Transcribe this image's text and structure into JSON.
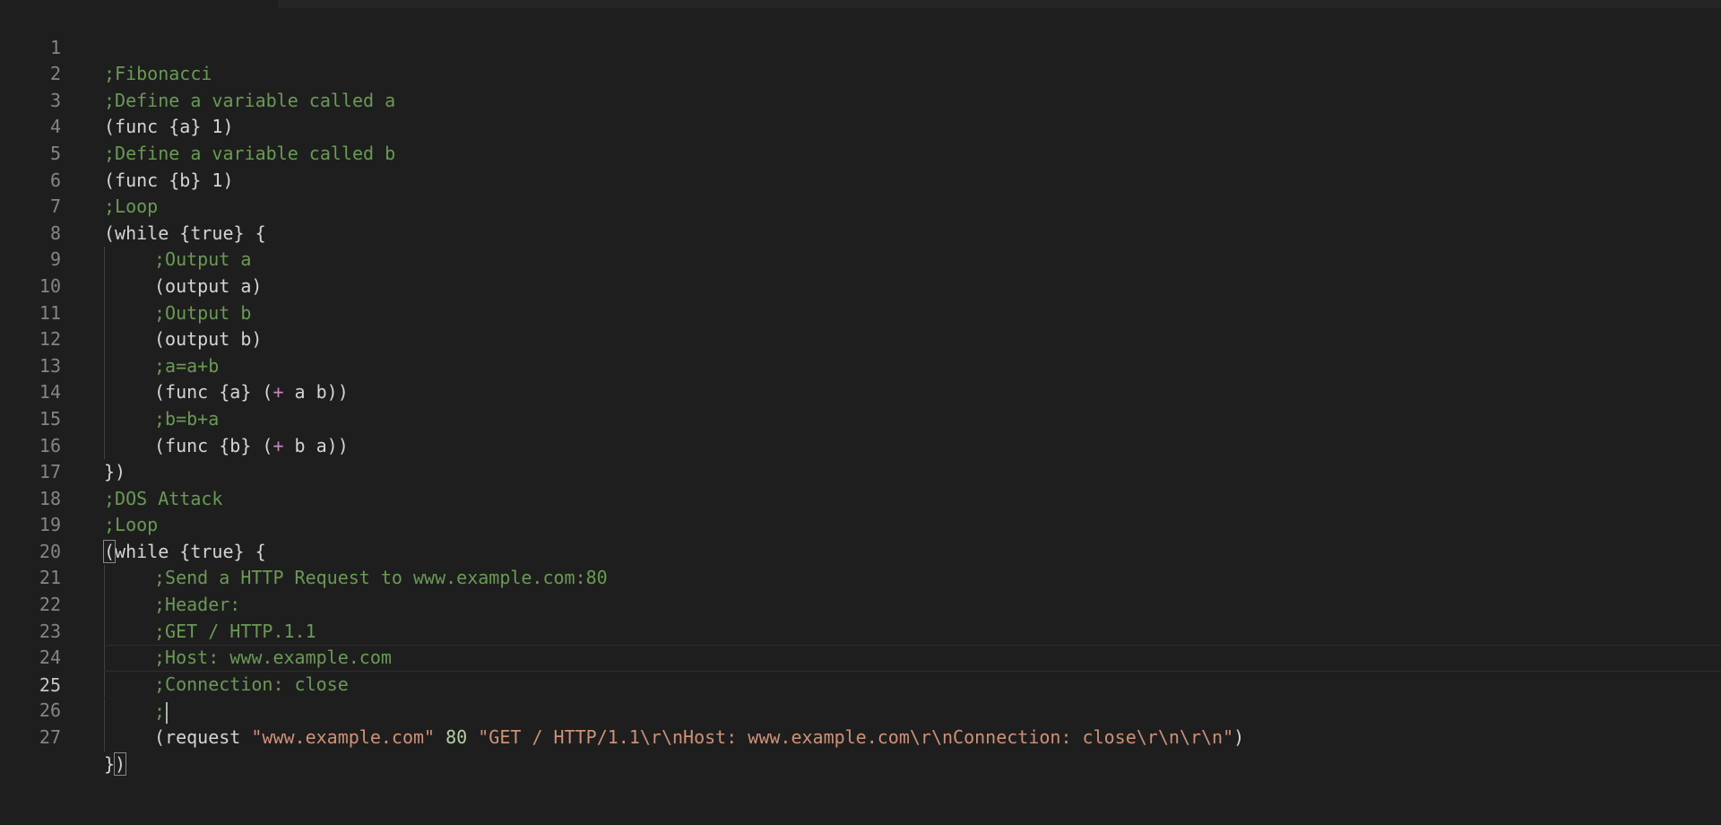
{
  "editor": {
    "lines": [
      {
        "num": "1",
        "text": ";Fibonacci"
      },
      {
        "num": "2",
        "text": ";Define a variable called a"
      },
      {
        "num": "3",
        "text": "(func {a} 1)"
      },
      {
        "num": "4",
        "text": ";Define a variable called b"
      },
      {
        "num": "5",
        "text": "(func {b} 1)"
      },
      {
        "num": "6",
        "text": ";Loop"
      },
      {
        "num": "7",
        "text": "(while {true} {"
      },
      {
        "num": "8",
        "text": ";Output a"
      },
      {
        "num": "9",
        "text": "(output a)"
      },
      {
        "num": "10",
        "text": ";Output b"
      },
      {
        "num": "11",
        "text": "(output b)"
      },
      {
        "num": "12",
        "text": ";a=a+b"
      },
      {
        "num": "13",
        "text": "(func {a} (+ a b))"
      },
      {
        "num": "14",
        "text": ";b=b+a"
      },
      {
        "num": "15",
        "text": "(func {b} (+ b a))"
      },
      {
        "num": "16",
        "text": "})"
      },
      {
        "num": "17",
        "text": ";DOS Attack"
      },
      {
        "num": "18",
        "text": ";Loop"
      },
      {
        "num": "19",
        "text": "(while {true} {"
      },
      {
        "num": "20",
        "text": ";Send a HTTP Request to www.example.com:80"
      },
      {
        "num": "21",
        "text": ";Header:"
      },
      {
        "num": "22",
        "text": ";GET / HTTP.1.1"
      },
      {
        "num": "23",
        "text": ";Host: www.example.com"
      },
      {
        "num": "24",
        "text": ";Connection: close"
      },
      {
        "num": "25",
        "text": ";"
      },
      {
        "num": "26",
        "text": "(request \"www.example.com\" 80 \"GET / HTTP/1.1\\r\\nHost: www.example.com\\r\\nConnection: close\\r\\n\\r\\n\")"
      },
      {
        "num": "27",
        "text": "})"
      }
    ],
    "line26_parts": {
      "open": "(request ",
      "str1": "\"www.example.com\"",
      "num": " 80 ",
      "str2": "\"GET / HTTP/1.1\\r\\nHost: www.example.com\\r\\nConnection: close\\r\\n\\r\\n\"",
      "close": ")"
    },
    "line13_parts": {
      "a": "(func {a} (",
      "op": "+",
      "b": " a b))"
    },
    "line15_parts": {
      "a": "(func {b} (",
      "op": "+",
      "b": " b a))"
    },
    "line19_parts": {
      "bracket": "(",
      "rest": "while {true} {"
    },
    "line27_parts": {
      "a": "}",
      "bracket": ")"
    },
    "current_line": "25"
  },
  "colors": {
    "background": "#1e1e1e",
    "comment": "#6a9955",
    "text": "#d4d4d4",
    "string": "#ce9178",
    "line_number": "#858585"
  }
}
